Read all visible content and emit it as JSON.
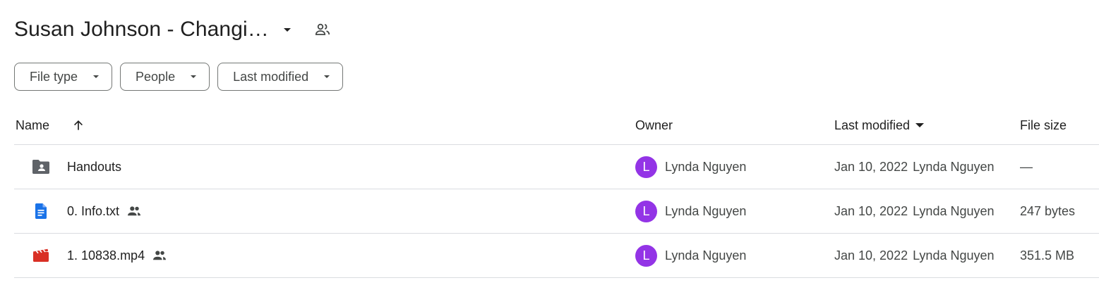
{
  "header": {
    "title": "Susan Johnson - Changi…",
    "icons": {
      "caret": "arrow-drop-down-icon",
      "shared": "people-icon"
    }
  },
  "filters": [
    {
      "label": "File type"
    },
    {
      "label": "People"
    },
    {
      "label": "Last modified"
    }
  ],
  "table": {
    "columns": {
      "name": "Name",
      "owner": "Owner",
      "last_modified": "Last modified",
      "file_size": "File size"
    },
    "sort": {
      "column": "Name",
      "direction": "ascending",
      "icon": "arrow-upward-icon"
    },
    "rows": [
      {
        "name": "Handouts",
        "type": "shared-folder",
        "icon_color": "#5f6368",
        "shared": false,
        "owner_initial": "L",
        "owner": "Lynda Nguyen",
        "modified_date": "Jan 10, 2022",
        "modified_by": "Lynda Nguyen",
        "size": "—"
      },
      {
        "name": "0. Info.txt",
        "type": "document",
        "icon_color": "#1a73e8",
        "shared": true,
        "owner_initial": "L",
        "owner": "Lynda Nguyen",
        "modified_date": "Jan 10, 2022",
        "modified_by": "Lynda Nguyen",
        "size": "247 bytes"
      },
      {
        "name": "1. 10838.mp4",
        "type": "video",
        "icon_color": "#d93025",
        "shared": true,
        "owner_initial": "L",
        "owner": "Lynda Nguyen",
        "modified_date": "Jan 10, 2022",
        "modified_by": "Lynda Nguyen",
        "size": "351.5 MB"
      }
    ]
  },
  "colors": {
    "avatar": "#9334e6",
    "text_primary": "#1f1f1f",
    "text_secondary": "#444746",
    "divider": "#dadce0"
  }
}
